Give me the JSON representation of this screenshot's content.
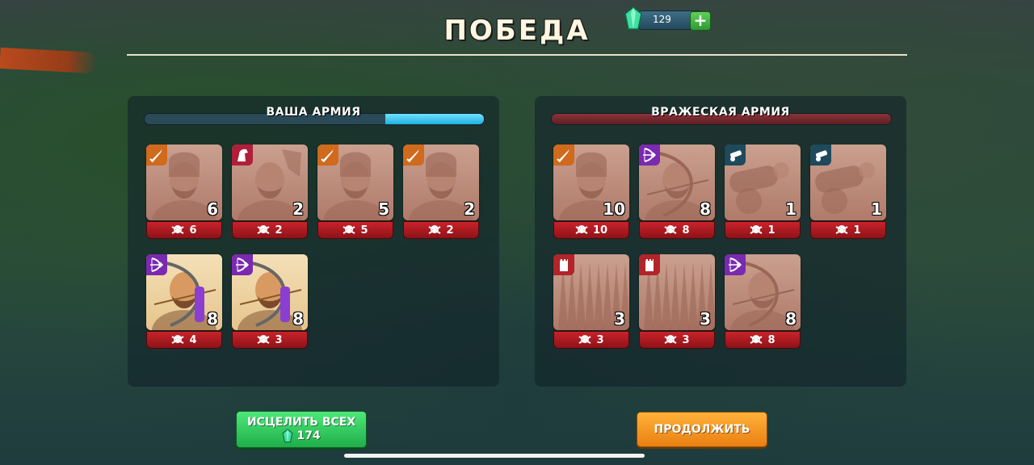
{
  "header": {
    "title": "ПОБЕДА"
  },
  "currency": {
    "gems": "129"
  },
  "your_army": {
    "title": "ВАША АРМИЯ",
    "health_fraction": 0.29,
    "units": [
      {
        "class": "sword",
        "count": "6",
        "losses": "6",
        "alive": false
      },
      {
        "class": "horse",
        "count": "2",
        "losses": "2",
        "alive": false
      },
      {
        "class": "sword",
        "count": "5",
        "losses": "5",
        "alive": false
      },
      {
        "class": "sword",
        "count": "2",
        "losses": "2",
        "alive": false
      },
      {
        "class": "bow",
        "count": "8",
        "losses": "4",
        "alive": true
      },
      {
        "class": "bow",
        "count": "8",
        "losses": "3",
        "alive": true
      }
    ]
  },
  "enemy_army": {
    "title": "ВРАЖЕСКАЯ АРМИЯ",
    "units": [
      {
        "class": "sword",
        "count": "10",
        "losses": "10"
      },
      {
        "class": "bow",
        "count": "8",
        "losses": "8"
      },
      {
        "class": "cannon",
        "count": "1",
        "losses": "1"
      },
      {
        "class": "cannon",
        "count": "1",
        "losses": "1"
      },
      {
        "class": "tower",
        "count": "3",
        "losses": "3"
      },
      {
        "class": "tower",
        "count": "3",
        "losses": "3"
      },
      {
        "class": "bow",
        "count": "8",
        "losses": "8"
      }
    ]
  },
  "buttons": {
    "heal_label": "ИСЦЕЛИТЬ ВСЕХ",
    "heal_cost": "174",
    "continue_label": "ПРОДОЛЖИТЬ"
  },
  "colors": {
    "victory_text": "#fff6e0",
    "heal_button": "#1fae4a",
    "continue_button": "#e97f12",
    "loss_bar": "#c8232a"
  }
}
